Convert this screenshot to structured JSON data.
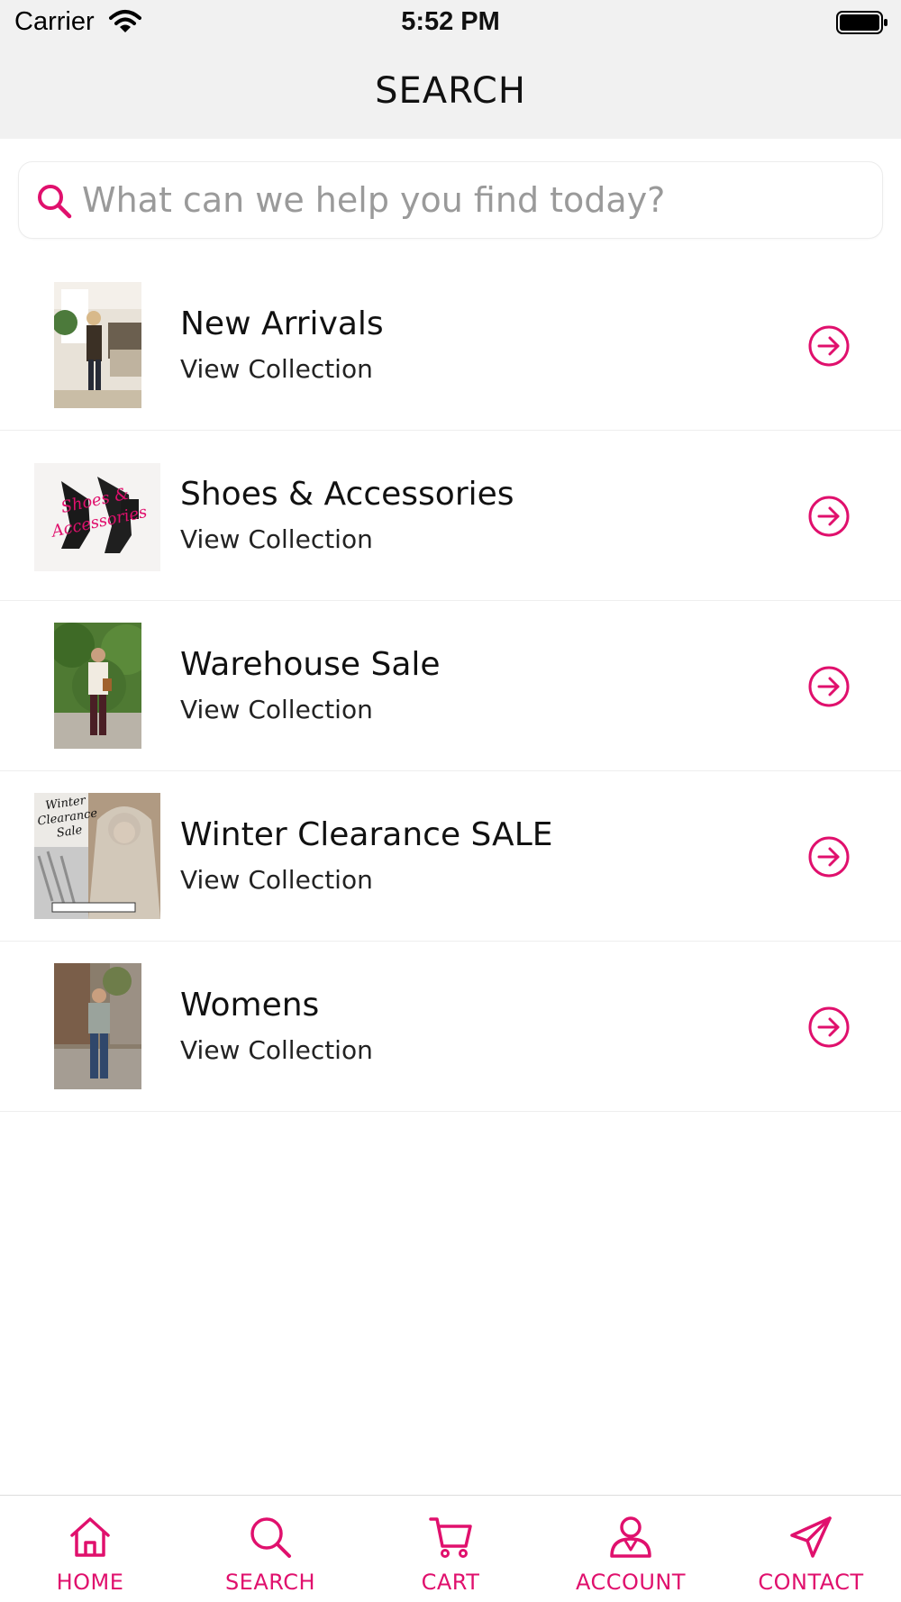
{
  "status_bar": {
    "carrier": "Carrier",
    "time": "5:52 PM"
  },
  "nav": {
    "title": "SEARCH"
  },
  "search": {
    "placeholder": "What can we help you find today?",
    "value": ""
  },
  "collections": [
    {
      "title": "New Arrivals",
      "subtitle": "View Collection",
      "thumb_icon": "woman-in-living-room-photo"
    },
    {
      "title": "Shoes & Accessories",
      "subtitle": "View Collection",
      "thumb_icon": "black-heels-photo",
      "thumb_text": "Shoes & Accessories"
    },
    {
      "title": "Warehouse Sale",
      "subtitle": "View Collection",
      "thumb_icon": "woman-outdoors-photo"
    },
    {
      "title": "Winter Clearance SALE",
      "subtitle": "View Collection",
      "thumb_icon": "woman-with-scarf-photo",
      "thumb_text": "Winter Clearance Sale"
    },
    {
      "title": "Womens",
      "subtitle": "View Collection",
      "thumb_icon": "woman-on-street-photo"
    }
  ],
  "tabs": [
    {
      "label": "HOME",
      "icon": "home-icon"
    },
    {
      "label": "SEARCH",
      "icon": "search-icon"
    },
    {
      "label": "CART",
      "icon": "cart-icon"
    },
    {
      "label": "ACCOUNT",
      "icon": "account-icon"
    },
    {
      "label": "CONTACT",
      "icon": "paper-plane-icon"
    }
  ],
  "colors": {
    "accent": "#e0106d",
    "header_bg": "#f1f1f1",
    "divider": "#eeeeee"
  }
}
